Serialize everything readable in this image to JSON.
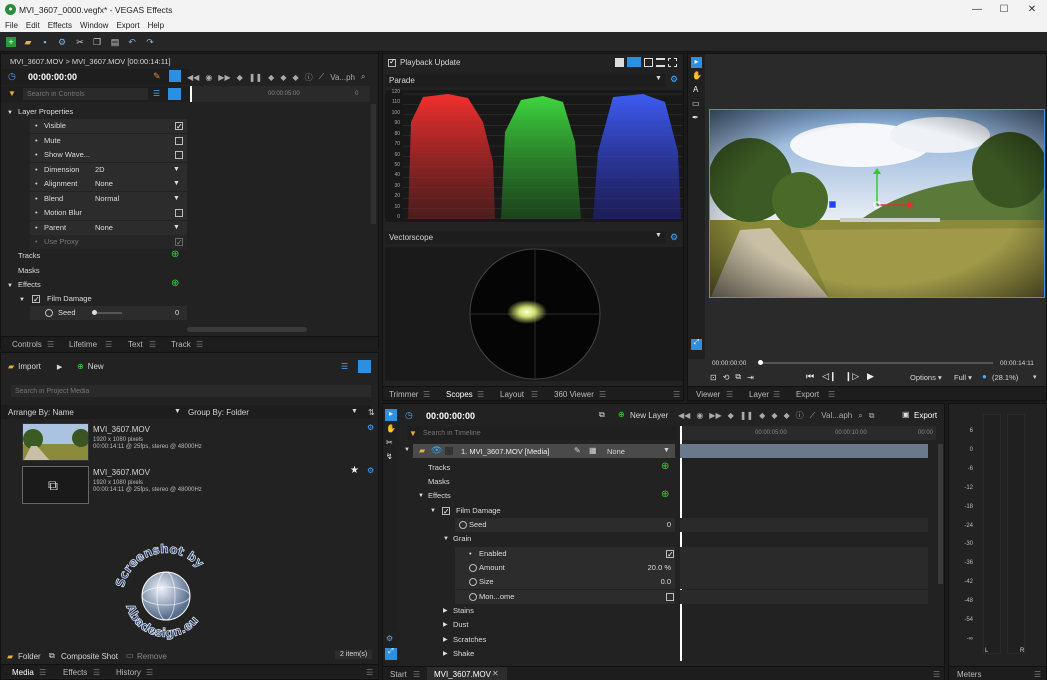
{
  "window": {
    "title": "MVI_3607_0000.vegfx* - VEGAS Effects",
    "minimize": "—",
    "maximize": "☐",
    "close": "✕"
  },
  "menu": [
    "File",
    "Edit",
    "Effects",
    "Window",
    "Export",
    "Help"
  ],
  "controls": {
    "breadcrumb": "MVI_3607.MOV > MVI_3607.MOV [00:00:14:11]",
    "timecode": "00:00:00:00",
    "graph_label": "Va...ph",
    "search_placeholder": "Search in Controls",
    "ruler_mark": "00:00:05:00",
    "layer_properties": "Layer Properties",
    "props": [
      {
        "label": "Visible",
        "type": "check",
        "checked": true
      },
      {
        "label": "Mute",
        "type": "check",
        "checked": false
      },
      {
        "label": "Show Wave...",
        "type": "check",
        "checked": false
      },
      {
        "label": "Dimension",
        "type": "select",
        "value": "2D"
      },
      {
        "label": "Alignment",
        "type": "select",
        "value": "None"
      },
      {
        "label": "Blend",
        "type": "select",
        "value": "Normal"
      },
      {
        "label": "Motion Blur",
        "type": "check",
        "checked": false
      },
      {
        "label": "Parent",
        "type": "select",
        "value": "None"
      },
      {
        "label": "Use Proxy",
        "type": "check",
        "checked": true
      }
    ],
    "tracks": "Tracks",
    "masks": "Masks",
    "effects": "Effects",
    "film_damage": "Film Damage",
    "seed": "Seed",
    "seed_value": "0",
    "tabs": [
      "Controls",
      "Lifetime",
      "Text",
      "Track"
    ]
  },
  "scopes": {
    "playback_update": "Playback Update",
    "parade_label": "Parade",
    "parade_ticks": [
      "120",
      "110",
      "100",
      "90",
      "80",
      "70",
      "60",
      "50",
      "40",
      "30",
      "20",
      "10",
      "0"
    ],
    "vectorscope_label": "Vectorscope",
    "tabs": [
      "Trimmer",
      "Scopes",
      "Layout",
      "360 Viewer"
    ]
  },
  "viewer": {
    "timecode_start": "00:00:00:00",
    "timecode_end": "00:00:14:11",
    "options": "Options",
    "quality": "Full",
    "zoom": "(28.1%)",
    "tabs": [
      "Viewer",
      "Layer",
      "Export"
    ]
  },
  "media": {
    "import": "Import",
    "new": "New",
    "search_placeholder": "Search in Project Media",
    "arrange": "Arrange By: Name",
    "group": "Group By: Folder",
    "items": [
      {
        "name": "MVI_3607.MOV",
        "res": "1920 x 1080 pixels",
        "info": "00:00:14:11 @ 25fps, stereo @ 48000Hz"
      },
      {
        "name": "MVI_3607.MOV",
        "res": "1920 x 1080 pixels",
        "info": "00:00:14:11 @ 25fps, stereo @ 48000Hz"
      }
    ],
    "watermark_top": "Screenshot by",
    "watermark_bottom": "Abadesign.eu",
    "folder": "Folder",
    "composite": "Composite Shot",
    "remove": "Remove",
    "count": "2 item(s)",
    "tabs": [
      "Media",
      "Effects",
      "History"
    ]
  },
  "timeline": {
    "timecode": "00:00:00:00",
    "new_layer": "New Layer",
    "graph_label": "Val...aph",
    "export": "Export",
    "search_placeholder": "Search in Timeline",
    "ruler": [
      "00:00:05:00",
      "00:00:10:00",
      "00:00"
    ],
    "layer_name": "1. MVI_3607.MOV [Media]",
    "layer_blend": "None",
    "rows": {
      "tracks": "Tracks",
      "masks": "Masks",
      "effects": "Effects",
      "film_damage": "Film Damage",
      "seed": "Seed",
      "seed_value": "0",
      "grain": "Grain",
      "enabled": "Enabled",
      "amount": "Amount",
      "amount_value": "20.0 %",
      "size": "Size",
      "size_value": "0.0",
      "mono": "Mon...ome",
      "stains": "Stains",
      "dust": "Dust",
      "scratches": "Scratches",
      "shake": "Shake"
    },
    "tabs": [
      "Start",
      "MVI_3607.MOV"
    ]
  },
  "meters": {
    "ticks": [
      "6",
      "0",
      "-6",
      "-12",
      "-18",
      "-24",
      "-30",
      "-36",
      "-42",
      "-48",
      "-54",
      "-∞"
    ],
    "left": "L",
    "right": "R",
    "tab": "Meters"
  }
}
